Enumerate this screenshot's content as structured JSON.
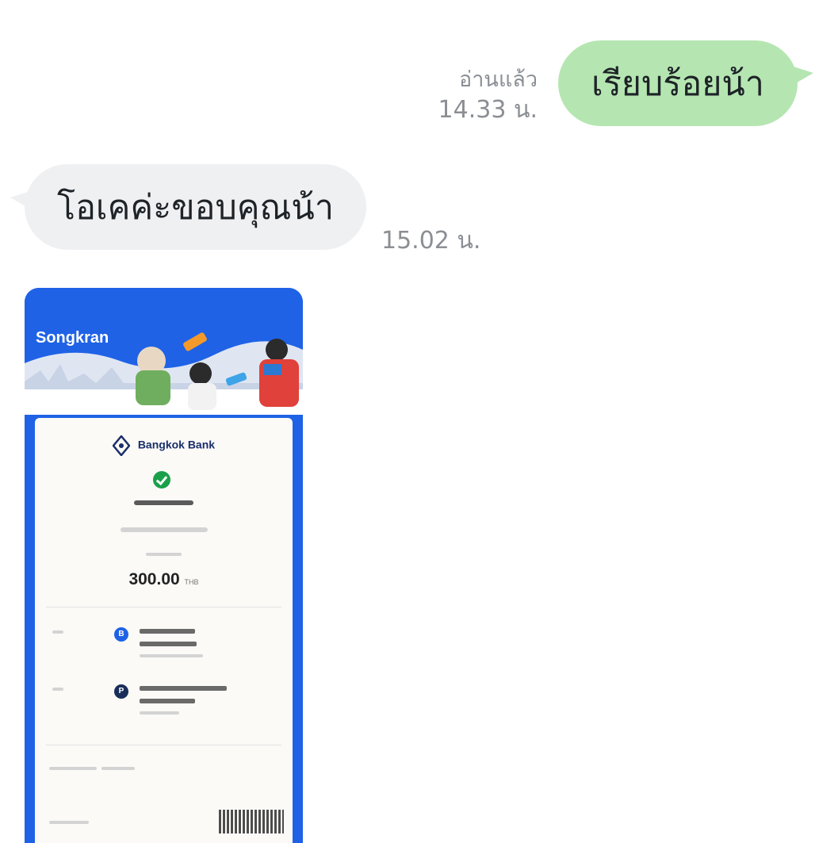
{
  "chat": {
    "outgoing": {
      "text": "เรียบร้อยน้า",
      "read_status": "อ่านแล้ว",
      "time": "14.33 น."
    },
    "incoming": {
      "text": "โอเคค่ะขอบคุณน้า",
      "time": "15.02 น."
    },
    "image_message": {
      "banner_title": "Songkran",
      "bank_name": "Bangkok Bank",
      "amount": "300.00",
      "amount_unit": "THB"
    }
  },
  "colors": {
    "outgoing_bubble": "#b5e6b1",
    "incoming_bubble": "#eff0f2",
    "meta_text": "#8b8f94",
    "slip_blue": "#1f62e6",
    "success_green": "#1aa04a"
  }
}
